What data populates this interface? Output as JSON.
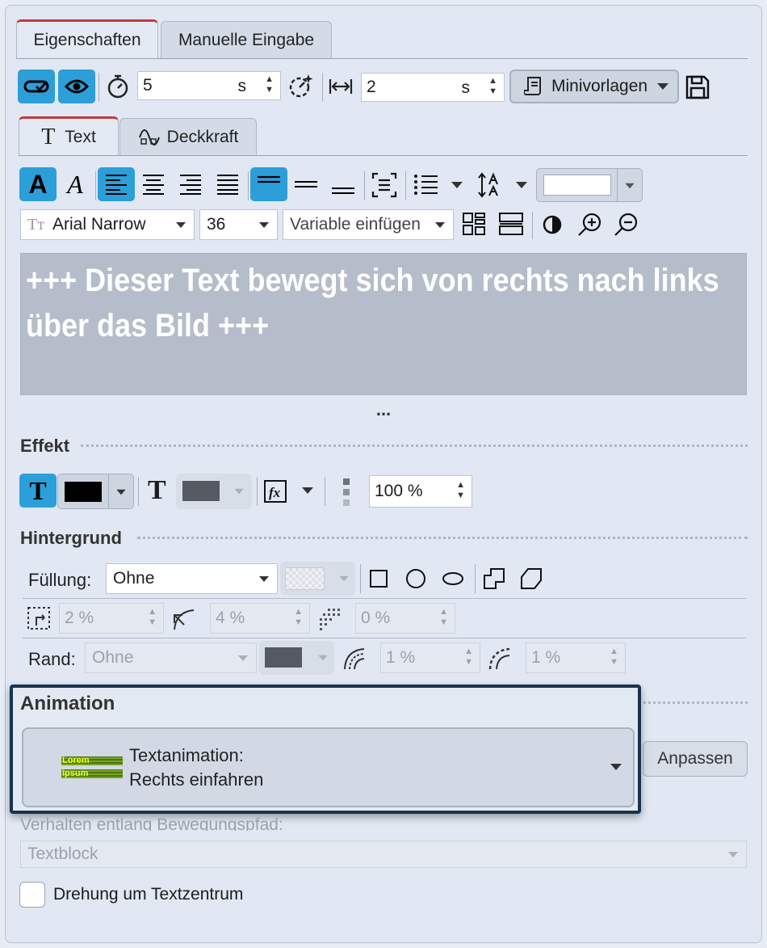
{
  "tabs": {
    "main": [
      "Eigenschaften",
      "Manuelle Eingabe"
    ],
    "sub": [
      "Text",
      "Deckkraft"
    ]
  },
  "toolbar": {
    "duration": {
      "value": "5",
      "unit": "s"
    },
    "transition": {
      "value": "2",
      "unit": "s"
    },
    "minivorlagen_label": "Minivorlagen"
  },
  "format": {
    "font": "Arial Narrow",
    "size": "36",
    "variable_placeholder": "Variable einfügen",
    "text_color": "#ffffff"
  },
  "editor": {
    "text": "+++ Dieser Text bewegt sich von rechts nach links über das Bild +++",
    "background": "#b4bdc9",
    "more": "..."
  },
  "effekt": {
    "title": "Effekt",
    "color": "#000000",
    "shadow_color": "#555a62",
    "opacity": "100 %"
  },
  "hintergrund": {
    "title": "Hintergrund",
    "fill_label": "Füllung:",
    "fill_value": "Ohne",
    "padding_value": "2 %",
    "radius_value": "4 %",
    "blur_value": "0 %",
    "rand_label": "Rand:",
    "rand_value": "Ohne",
    "rand_width": "1 %",
    "rand_radius": "1 %"
  },
  "animation": {
    "title": "Animation",
    "thumb_lines": [
      "Lorem",
      "Ipsum"
    ],
    "selected_line1": "Textanimation:",
    "selected_line2": "Rechts einfahren",
    "customize_button": "Anpassen",
    "highlight_color": "#17344f"
  },
  "path": {
    "label": "Verhalten entlang Bewegungspfad:",
    "value": "Textblock"
  },
  "rotation_checkbox": {
    "label": "Drehung um Textzentrum",
    "checked": false
  }
}
